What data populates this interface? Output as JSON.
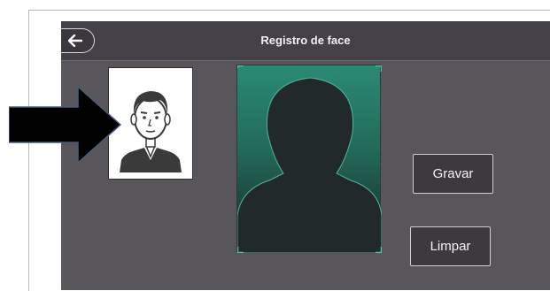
{
  "header": {
    "title": "Registro de face"
  },
  "icons": {
    "back": "arrow-left-icon",
    "photo": "person-avatar-icon",
    "preview": "face-silhouette-icon",
    "pointer": "arrow-right-icon"
  },
  "actions": {
    "save_label": "Gravar",
    "clear_label": "Limpar"
  },
  "colors": {
    "screen_bg": "#59565b",
    "titlebar_bg": "#434047",
    "preview_teal": "#2a8a74",
    "button_bg": "#3c393f",
    "arrow": "#000000"
  }
}
